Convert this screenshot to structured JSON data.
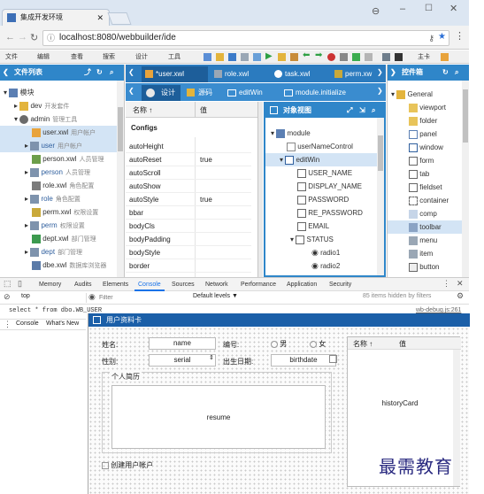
{
  "browser": {
    "tab_title": "集成开发环境",
    "url": "localhost:8080/webbuilder/ide"
  },
  "menubar": [
    "文件",
    "编辑",
    "查看",
    "搜索",
    "设计",
    "工具"
  ],
  "menubar_right": "主卡",
  "file_panel": {
    "title": "文件列表",
    "items": [
      {
        "label": "模块",
        "cn": ""
      },
      {
        "label": "dev",
        "cn": "开发套件"
      },
      {
        "label": "admin",
        "cn": "管理工具"
      },
      {
        "label": "user.xwl",
        "cn": "用户帐户"
      },
      {
        "label": "user",
        "cn": "用户帐户"
      },
      {
        "label": "person.xwl",
        "cn": "人员管理"
      },
      {
        "label": "person",
        "cn": "人员管理"
      },
      {
        "label": "role.xwl",
        "cn": "角色配置"
      },
      {
        "label": "role",
        "cn": "角色配置"
      },
      {
        "label": "perm.xwl",
        "cn": "权限设置"
      },
      {
        "label": "perm",
        "cn": "权限设置"
      },
      {
        "label": "dept.xwl",
        "cn": "部门管理"
      },
      {
        "label": "dept",
        "cn": "部门管理"
      },
      {
        "label": "dbe.xwl",
        "cn": "数据库浏览器"
      }
    ]
  },
  "editor_tabs": [
    "*user.xwl",
    "role.xwl",
    "task.xwl",
    "perm.xw"
  ],
  "design_tabs": [
    "设计",
    "源码",
    "editWin",
    "module.initialize"
  ],
  "props": {
    "col_name": "名称 ↑",
    "col_value": "值",
    "group": "Configs",
    "rows": [
      {
        "name": "autoHeight",
        "value": ""
      },
      {
        "name": "autoReset",
        "value": "true"
      },
      {
        "name": "autoScroll",
        "value": ""
      },
      {
        "name": "autoShow",
        "value": ""
      },
      {
        "name": "autoStyle",
        "value": "true"
      },
      {
        "name": "bbar",
        "value": ""
      },
      {
        "name": "bodyCls",
        "value": ""
      },
      {
        "name": "bodyPadding",
        "value": ""
      },
      {
        "name": "bodyStyle",
        "value": ""
      },
      {
        "name": "border",
        "value": ""
      }
    ]
  },
  "object_view": {
    "title": "对象视图",
    "items": [
      "module",
      "userNameControl",
      "editWin",
      "USER_NAME",
      "DISPLAY_NAME",
      "PASSWORD",
      "RE_PASSWORD",
      "EMAIL",
      "STATUS",
      "radio1",
      "radio2"
    ]
  },
  "controls_panel": {
    "title": "控件箱",
    "items": [
      "General",
      "viewport",
      "folder",
      "panel",
      "window",
      "form",
      "tab",
      "fieldset",
      "container",
      "comp",
      "toolbar",
      "menu",
      "item",
      "button",
      "hidden"
    ]
  },
  "devtools": {
    "tabs": [
      "Memory",
      "Audits",
      "Elements",
      "Console",
      "Sources",
      "Network",
      "Performance",
      "Application",
      "Security"
    ],
    "context": "top",
    "filter_placeholder": "Filter",
    "levels": "Default levels ▼",
    "hidden_note": "85 items hidden by filters",
    "sql": "select * from dbo.WB_USER",
    "sql_right": "wb-debug.js:261",
    "bottom_tabs": [
      "Console",
      "What's New"
    ]
  },
  "form": {
    "title": "用户资料卡",
    "name_label": "姓名:",
    "name_value": "name",
    "code_label": "编号:",
    "male": "男",
    "female": "女",
    "gender_label": "性别:",
    "serial_value": "serial",
    "birth_label": "出生日期:",
    "birth_value": "birthdate",
    "intro_label": "个人简历",
    "resume_value": "resume",
    "create_account": "创建用户帐户",
    "grid_col_name": "名称 ↑",
    "grid_col_value": "值",
    "history_value": "historyCard"
  },
  "watermark": "最需教育"
}
